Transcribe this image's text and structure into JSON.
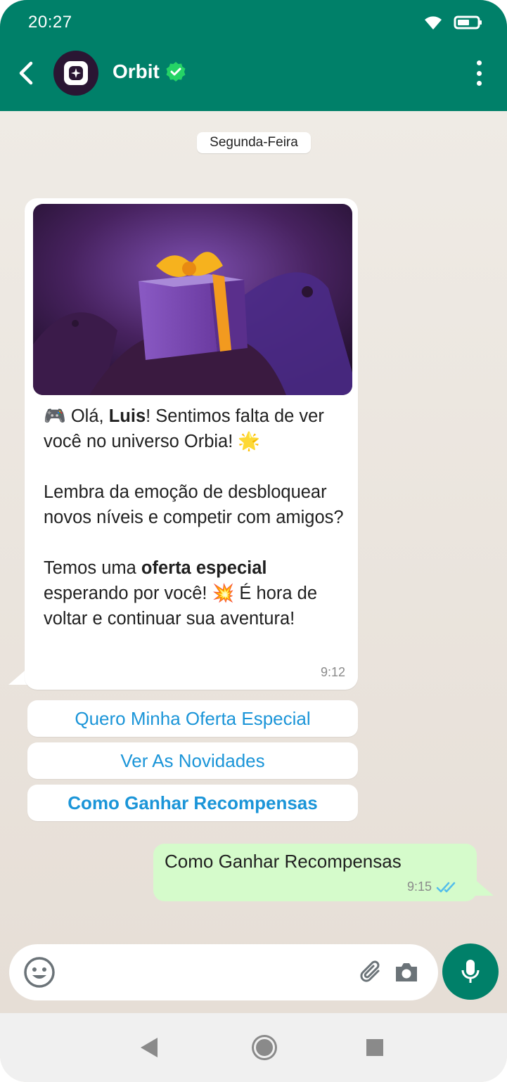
{
  "status_bar": {
    "time": "20:27"
  },
  "header": {
    "contact_name": "Orbit",
    "verified": true
  },
  "chat": {
    "date_chip": "Segunda-Feira",
    "incoming": {
      "emoji_game": "🎮",
      "line1_pre": " Olá, ",
      "line1_name": "Luis",
      "line1_post": "! Sentimos falta de ver você no universo Orbia! ",
      "emoji_star": "🌟",
      "para2": "Lembra da emoção de desbloquear novos níveis e competir com amigos?",
      "para3_pre": "Temos uma ",
      "para3_bold": "oferta especial",
      "para3_mid": " esperando por você! ",
      "emoji_boom": "💥",
      "para3_post": " É hora de voltar e continuar sua aventura!",
      "time": "9:12"
    },
    "quick_replies": [
      {
        "label": "Quero Minha Oferta Especial"
      },
      {
        "label": "Ver As Novidades"
      },
      {
        "label": "Como Ganhar Recompensas"
      }
    ],
    "outgoing": {
      "text": "Como Ganhar Recompensas",
      "time": "9:15",
      "status": "read"
    }
  },
  "composer": {
    "placeholder": ""
  },
  "colors": {
    "header": "#008069",
    "link_blue": "#1b95d8",
    "out_bubble": "#d5fbcb",
    "verified": "#25d366"
  }
}
